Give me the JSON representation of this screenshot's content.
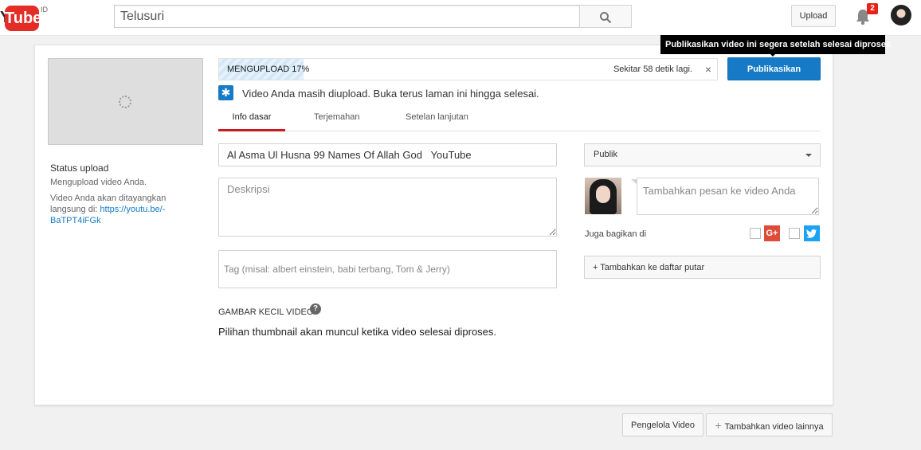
{
  "header": {
    "logo_text": "YouTube",
    "logo_tube": "Tube",
    "country": "ID",
    "search_placeholder": "Telusuri",
    "upload_label": "Upload",
    "notification_count": "2"
  },
  "tooltip": {
    "text": "Publikasikan video ini segera setelah selesai diproses"
  },
  "upload": {
    "progress_label": "MENGUPLOAD 17%",
    "progress_percent": 17,
    "time_remaining": "Sekitar 58 detik lagi.",
    "close_glyph": "×",
    "publish_label": "Publikasikan",
    "notice": "Video Anda masih diupload. Buka terus laman ini hingga selesai."
  },
  "status": {
    "title": "Status upload",
    "line1": "Mengupload video Anda.",
    "line2": "Video Anda akan ditayangkan langsung di: ",
    "url": "https://youtu.be/-BaTPT4iFGk"
  },
  "tabs": [
    {
      "label": "Info dasar",
      "active": true
    },
    {
      "label": "Terjemahan",
      "active": false
    },
    {
      "label": "Setelan lanjutan",
      "active": false
    }
  ],
  "form": {
    "title_value": "Al Asma Ul Husna 99 Names Of Allah God   YouTube",
    "description_placeholder": "Deskripsi",
    "tags_placeholder": "Tag (misal: albert einstein, babi terbang, Tom & Jerry)",
    "thumbnail_heading": "GAMBAR KECIL VIDEO",
    "help_glyph": "?",
    "thumbnail_note": "Pilihan thumbnail akan muncul ketika video selesai diproses."
  },
  "sidebar_right": {
    "privacy_value": "Publik",
    "message_placeholder": "Tambahkan pesan ke video Anda",
    "share_label": "Juga bagikan di",
    "gplus_glyph": "G+",
    "playlist_label": "+ Tambahkan ke daftar putar"
  },
  "footer": {
    "video_manager_label": "Pengelola Video",
    "add_more_label": "Tambahkan video lainnya",
    "add_more_glyph": "+"
  },
  "colors": {
    "brand_red": "#e52d27",
    "primary_blue": "#167ac6",
    "active_tab": "#cc181e"
  }
}
